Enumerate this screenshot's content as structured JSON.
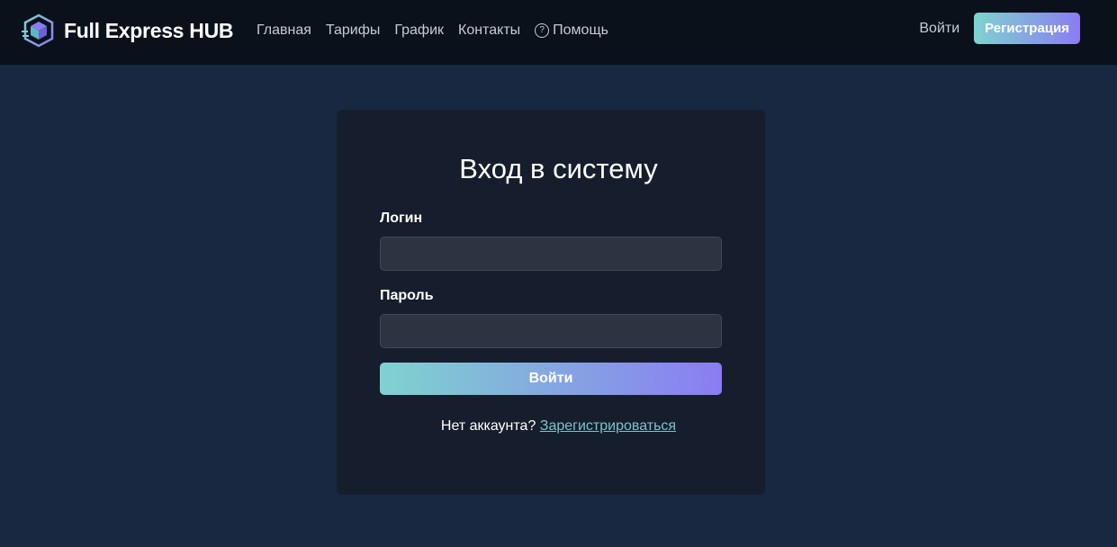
{
  "header": {
    "brand_name": "Full Express HUB",
    "logo_icon": "cube-logo-icon",
    "nav": [
      {
        "label": "Главная"
      },
      {
        "label": "Тарифы"
      },
      {
        "label": "График"
      },
      {
        "label": "Контакты"
      },
      {
        "label": "Помощь",
        "icon": "help-circle-icon",
        "icon_glyph": "?"
      }
    ],
    "login_label": "Войти",
    "register_label": "Регистрация"
  },
  "login_form": {
    "title": "Вход в систему",
    "login_label": "Логин",
    "login_value": "",
    "password_label": "Пароль",
    "password_value": "",
    "submit_label": "Войти",
    "no_account_text": "Нет аккаунта?",
    "signup_link": "Зарегистрироваться"
  },
  "colors": {
    "page_background": "#172840",
    "header_background": "#0a111b",
    "card_background": "#161e2d",
    "input_background": "#2b3440",
    "gradient_start": "#7fd3cf",
    "gradient_end": "#8a7cf2",
    "link": "#7cc2cc"
  }
}
